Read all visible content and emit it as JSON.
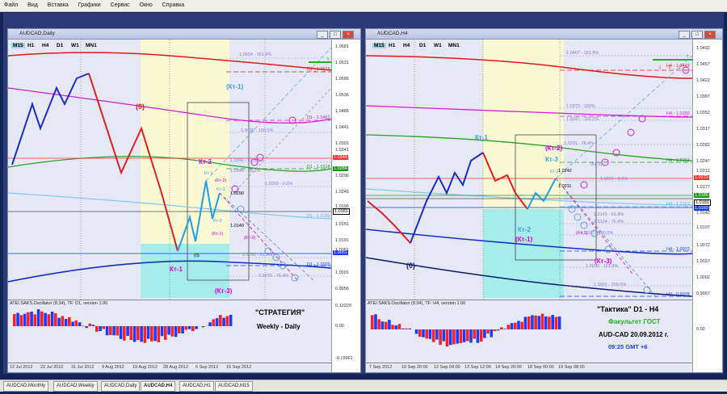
{
  "menu": [
    "Файл",
    "Вид",
    "Вставка",
    "Графики",
    "Сервис",
    "Окно",
    "Справка"
  ],
  "colors": {
    "frame": "#2a3b78",
    "bull": "#ff2020",
    "bear": "#1a3cff",
    "fibo": "#6c6cd8",
    "magenta": "#e000e0",
    "cyan_zone": "#a6ecea",
    "yellow_zone": "#fbf8d4"
  },
  "left": {
    "title": "AUDCAD,Daily",
    "tf_buttons": [
      "M15",
      "H1",
      "H4",
      "D1",
      "W1",
      "MN1"
    ],
    "active_tf": "M15",
    "price_scale": [
      "1.0681",
      "1.0631",
      "1.0586",
      "1.0536",
      "1.0486",
      "1.0441",
      "1.0391",
      "1.0341",
      "1.0296",
      "1.0246",
      "1.0196",
      "1.0151",
      "1.0101",
      "1.0051",
      "1.0001",
      "0.9956"
    ],
    "price_boxes": [
      {
        "text": "1.0344",
        "bg": "#ff3030",
        "fg": "#fff"
      },
      {
        "text": "1.0284",
        "bg": "#189a18",
        "fg": "#fff"
      },
      {
        "text": "1.0181",
        "bg": "#ffffff",
        "fg": "#000"
      },
      {
        "text": "1.0051",
        "bg": "#1a3cff",
        "fg": "#fff"
      }
    ],
    "levels": [
      {
        "text": "1.0654 - 161.8%",
        "color": "#a070d0"
      },
      {
        "text": "D1 - 1.0616",
        "color": "#e02020"
      },
      {
        "text": "D1 - 1.0467",
        "color": "#d020d0"
      },
      {
        "text": "1.0430 - 100.0%",
        "color": "#8080d0"
      },
      {
        "text": "1.0340 - 61.8%",
        "color": "#8080d0"
      },
      {
        "text": "D1 - 1.0318",
        "color": "#20a020"
      },
      {
        "text": "1.0269 - 0.0%",
        "color": "#8080d0"
      },
      {
        "text": "1.0290",
        "color": "#000"
      },
      {
        "text": "D1 - 1.0189",
        "color": "#60b0e0"
      },
      {
        "text": "1.0140",
        "color": "#000"
      },
      {
        "text": "1.0052 - 61.8%",
        "color": "#8080d0"
      },
      {
        "text": "D1 - 1.0020",
        "color": "#1a3cff"
      },
      {
        "text": "0.9979 - 76.4%",
        "color": "#8080d0"
      },
      {
        "text": "1.0246 - 38.2%",
        "color": "#8080d0"
      }
    ],
    "labels": [
      "(0)",
      "(Кт-1)",
      "Кт-2",
      "Кт-1",
      "(Кт-2)",
      "Кт-3",
      "Кт-2",
      "(Кт-1)",
      "(Кт-3)",
      "Кт-1",
      "(0)",
      "(Кт-3)"
    ],
    "osc_title": "ATEI.SAKS.Oscillator (8.34), TF: D1, version 1.00",
    "osc_scale": [
      "0.12229",
      "0.00",
      "-0.19961"
    ],
    "dates": [
      "12 Jul 2012",
      "22 Jul 2012",
      "31 Jul 2012",
      "9 Aug 2012",
      "19 Aug 2012",
      "28 Aug 2012",
      "6 Sep 2012",
      "16 Sep 2012"
    ],
    "caption1": "\"СТРАТЕГИЯ\"",
    "caption2": "Weekly - Daily"
  },
  "right": {
    "title": "AUDCAD,H4",
    "tf_buttons": [
      "M15",
      "H1",
      "H4",
      "D1",
      "W1",
      "MN1"
    ],
    "active_tf": "M15",
    "price_scale": [
      "1.0492",
      "1.0457",
      "1.0422",
      "1.0387",
      "1.0352",
      "1.0317",
      "1.0282",
      "1.0247",
      "1.0212",
      "1.0177",
      "1.0142",
      "1.0107",
      "1.0072",
      "1.0037",
      "1.0002",
      "0.9967"
    ],
    "price_boxes": [
      {
        "text": "1.0223",
        "bg": "#ff3030",
        "fg": "#fff"
      },
      {
        "text": "1.0186",
        "bg": "#189a18",
        "fg": "#fff"
      },
      {
        "text": "1.0181",
        "bg": "#ffffff",
        "fg": "#000"
      },
      {
        "text": "1.0160",
        "bg": "#1a3cff",
        "fg": "#fff"
      }
    ],
    "levels": [
      {
        "text": "1.0467 - 161.8%",
        "color": "#a070d0"
      },
      {
        "text": "H4 - 1.0443",
        "color": "#e02020"
      },
      {
        "text": "1.0373 - 190%",
        "color": "#8080d0"
      },
      {
        "text": "1.0347 - 100.0%",
        "color": "#8080d0"
      },
      {
        "text": "H4 - 1.0350",
        "color": "#d020d0"
      },
      {
        "text": "1.0291 - 76.4%",
        "color": "#8080d0"
      },
      {
        "text": "H4 - 1.0263",
        "color": "#20a020"
      },
      {
        "text": "1.0242",
        "color": "#000"
      },
      {
        "text": "1.0211",
        "color": "#000"
      },
      {
        "text": "1.0201 - 0.0%",
        "color": "#8080d0"
      },
      {
        "text": "H4 - 1.0161",
        "color": "#60b0e0"
      },
      {
        "text": "1.0124 - 76.4%",
        "color": "#8080d0"
      },
      {
        "text": "1.0141 - 61.8%",
        "color": "#8080d0"
      },
      {
        "text": "1.0107 - 100.0%",
        "color": "#8080d0"
      },
      {
        "text": "H4 - 1.0073",
        "color": "#1a3cff"
      },
      {
        "text": "1.0000 - 161.8%",
        "color": "#8080d0"
      },
      {
        "text": "1.0991 - 200.0%",
        "color": "#8080d0"
      },
      {
        "text": "H4 - 0.9978",
        "color": "#1a3cff"
      }
    ],
    "labels": [
      "Кт-1",
      "(Кт-2)",
      "Кт-3",
      "Кт-1",
      "(Кт-3)",
      "Кт-2",
      "(Кт-1)",
      "(Кт-1)",
      "(Кт-3)",
      "(0)"
    ],
    "osc_title": "ATEI.SAKS.Oscillator (8.34), TF: H4, version 1.00",
    "osc_scale": [
      "0.00"
    ],
    "dates": [
      "7 Sep 2012",
      "10 Sep 20:00",
      "12 Sep 04:00",
      "13 Sep 12:00",
      "14 Sep 20:00",
      "18 Sep 00:00",
      "19 Sep 08:00"
    ],
    "caption1": "\"Тактика\"  D1 - H4",
    "caption2": "Факультет ГОСТ",
    "caption3": "AUD-CAD 20.09.2012  г.",
    "caption4": "09:25   GMT +6"
  },
  "tabs": [
    "AUDCAD,Monthly",
    "AUDCAD,Weekly",
    "AUDCAD,Daily",
    "AUDCAD,H4",
    "AUDCAD,H1",
    "AUDCAD,M15"
  ],
  "active_tab": "AUDCAD,H4"
}
